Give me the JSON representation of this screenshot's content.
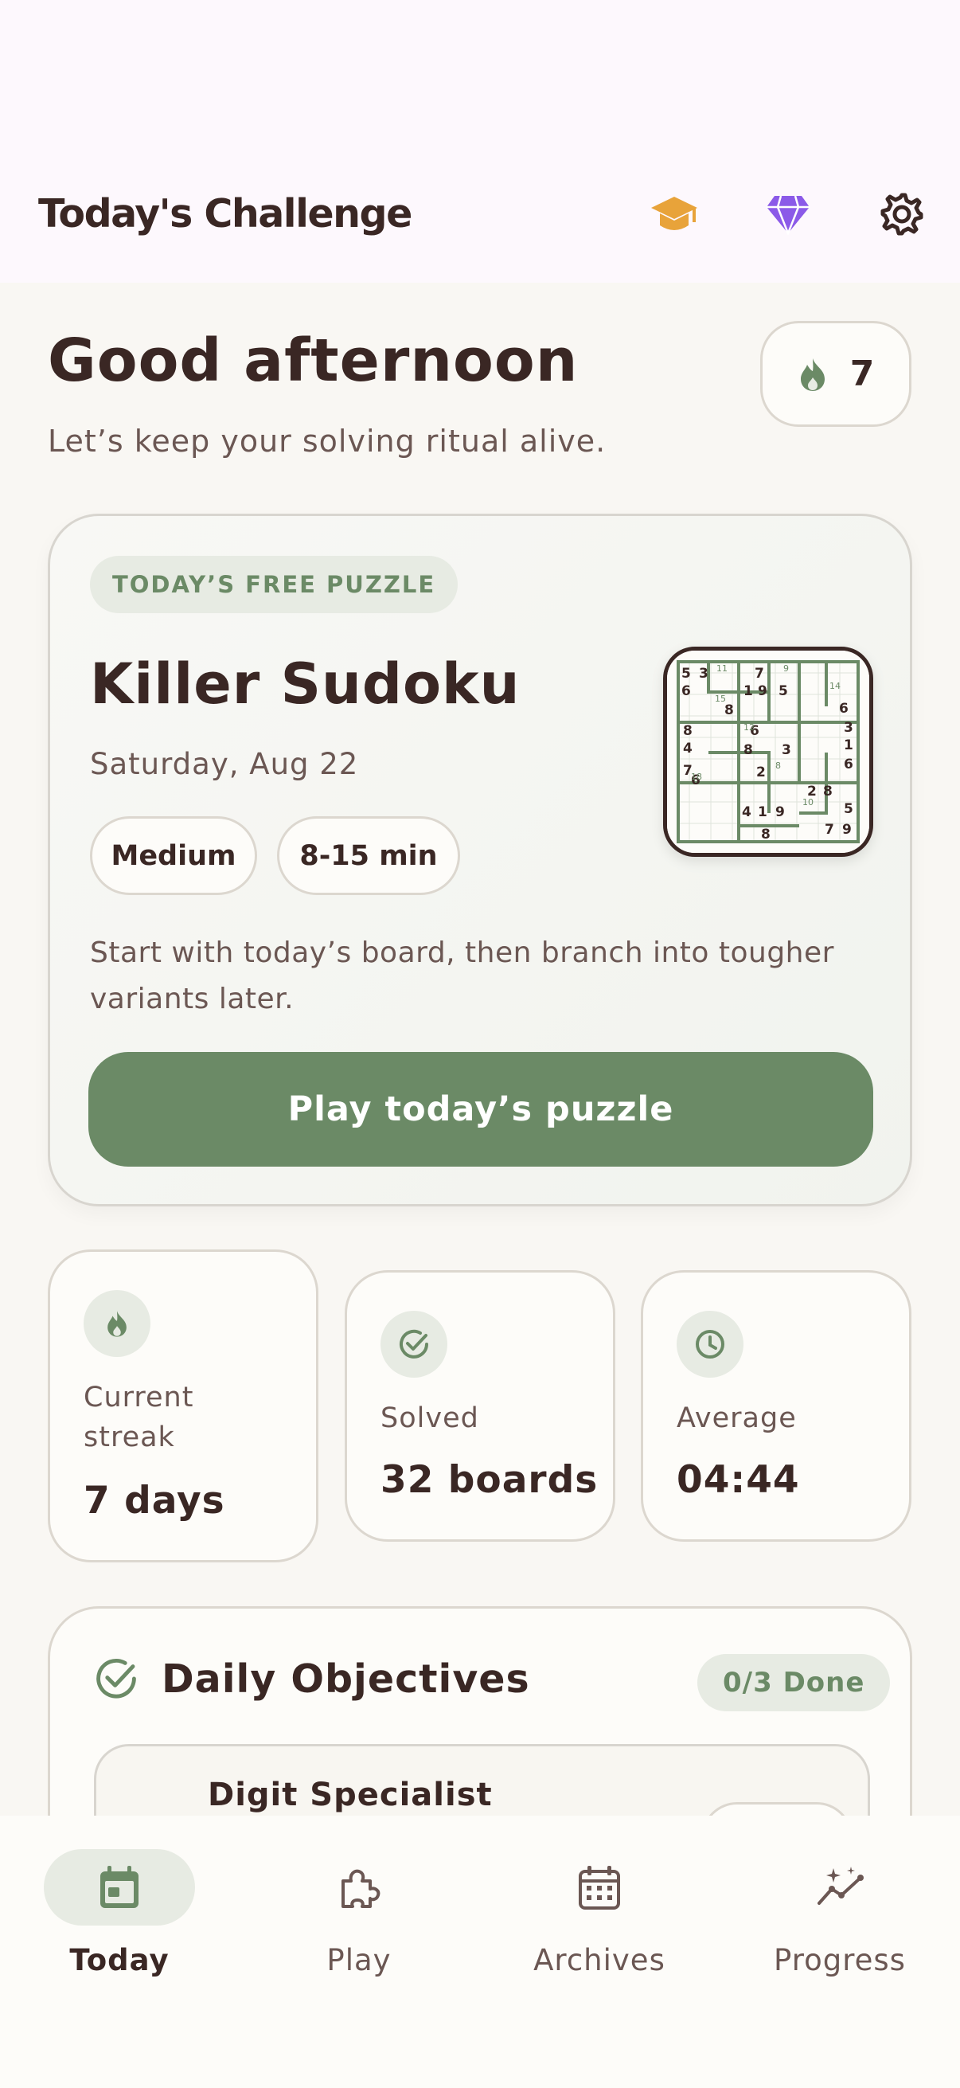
{
  "header": {
    "title": "Today's Challenge",
    "icons": [
      "graduation-cap-icon",
      "gem-icon",
      "gear-icon"
    ]
  },
  "greeting": {
    "title": "Good afternoon",
    "subtitle": "Let’s keep your solving ritual alive.",
    "streak_count": "7"
  },
  "hero": {
    "tag": "TODAY’S FREE PUZZLE",
    "puzzle_name": "Killer Sudoku",
    "date": "Saturday, Aug 22",
    "difficulty": "Medium",
    "duration": "8-15 min",
    "description": "Start with today’s board, then branch into tougher variants later.",
    "play_label": "Play today’s puzzle"
  },
  "stats": [
    {
      "label": "Current streak",
      "value": "7 days",
      "icon": "flame-icon"
    },
    {
      "label": "Solved",
      "value": "32 boards",
      "icon": "check-circle-icon"
    },
    {
      "label": "Average",
      "value": "04:44",
      "icon": "clock-icon"
    }
  ],
  "objectives": {
    "title": "Daily Objectives",
    "progress": "0/3 Done",
    "items": [
      {
        "title": "Digit Specialist"
      }
    ]
  },
  "nav": {
    "tabs": [
      {
        "label": "Today",
        "icon": "calendar-today-icon",
        "active": true
      },
      {
        "label": "Play",
        "icon": "puzzle-icon",
        "active": false
      },
      {
        "label": "Archives",
        "icon": "calendar-grid-icon",
        "active": false
      },
      {
        "label": "Progress",
        "icon": "chart-sparkle-icon",
        "active": false
      }
    ]
  },
  "colors": {
    "accent": "#6b8a66",
    "text": "#3a2724",
    "background": "#f9f7f3",
    "cap": "#e8a33a",
    "gem": "#8b5ae8"
  }
}
